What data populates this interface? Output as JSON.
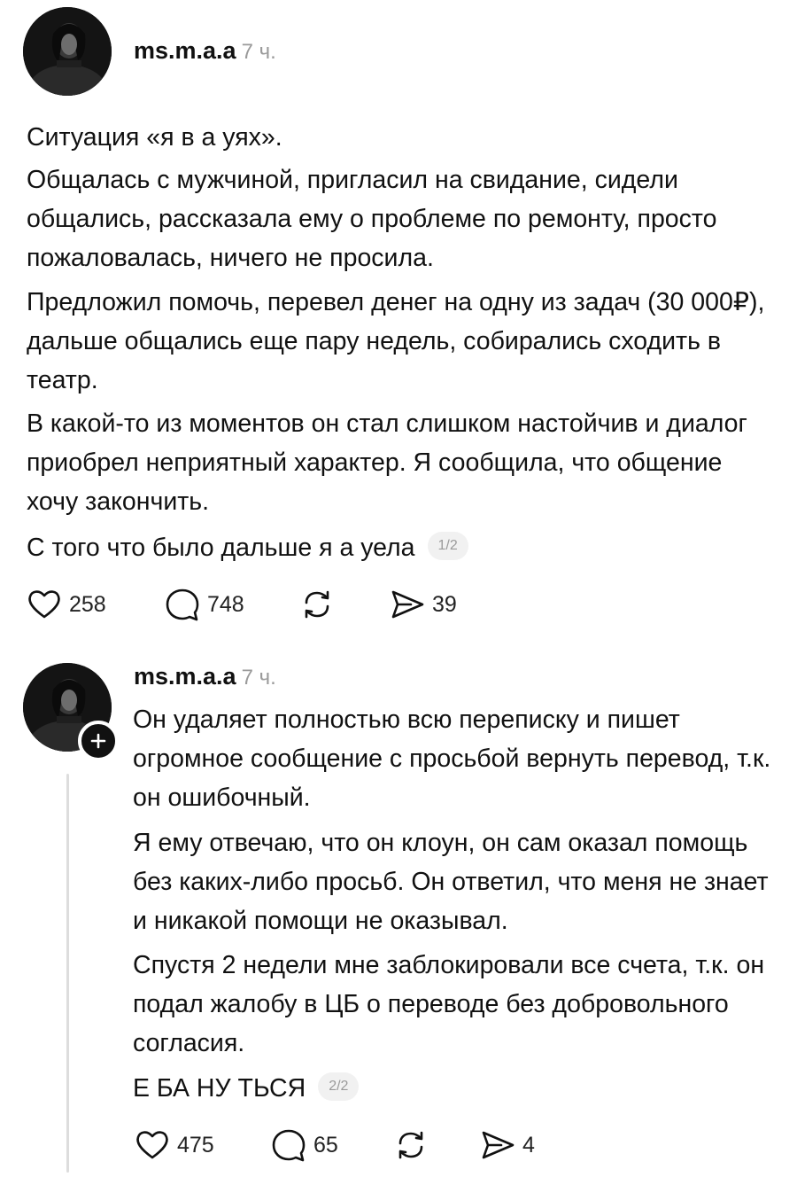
{
  "post1": {
    "username": "ms.m.a.a",
    "time": "7 ч.",
    "paragraphs": [
      "Ситуация «я в а  уях».",
      "Общалась с мужчиной, пригласил на свидание, сидели общались, рассказала ему о проблеме по ремонту, просто пожаловалась, ничего не просила.",
      "Предложил помочь, перевел денег на одну из задач (30 000₽), дальше общались еще пару недель, собирались сходить в театр.",
      "В какой-то из моментов он стал слишком настойчив и диалог приобрел неприятный характер. Я сообщила, что общение хочу закончить.",
      "С того что было дальше я а  уела"
    ],
    "page_indicator": "1/2",
    "likes": "258",
    "comments": "748",
    "shares": "39"
  },
  "post2": {
    "username": "ms.m.a.a",
    "time": "7 ч.",
    "paragraphs": [
      "Он удаляет полностью всю переписку и пишет огромное сообщение с просьбой вернуть перевод, т.к. он ошибочный.",
      "Я ему отвечаю, что он клоун, он сам оказал помощь без каких-либо просьб. Он ответил, что меня не знает и никакой помощи не оказывал.",
      "Спустя 2 недели мне заблокировали все счета, т.к. он подал жалобу в ЦБ о переводе без добровольного согласия.",
      "Е БА НУ ТЬСЯ"
    ],
    "page_indicator": "2/2",
    "likes": "475",
    "comments": "65",
    "shares": "4"
  },
  "icons": [
    "heart-icon",
    "comment-icon",
    "repost-icon",
    "share-icon",
    "plus-icon"
  ]
}
